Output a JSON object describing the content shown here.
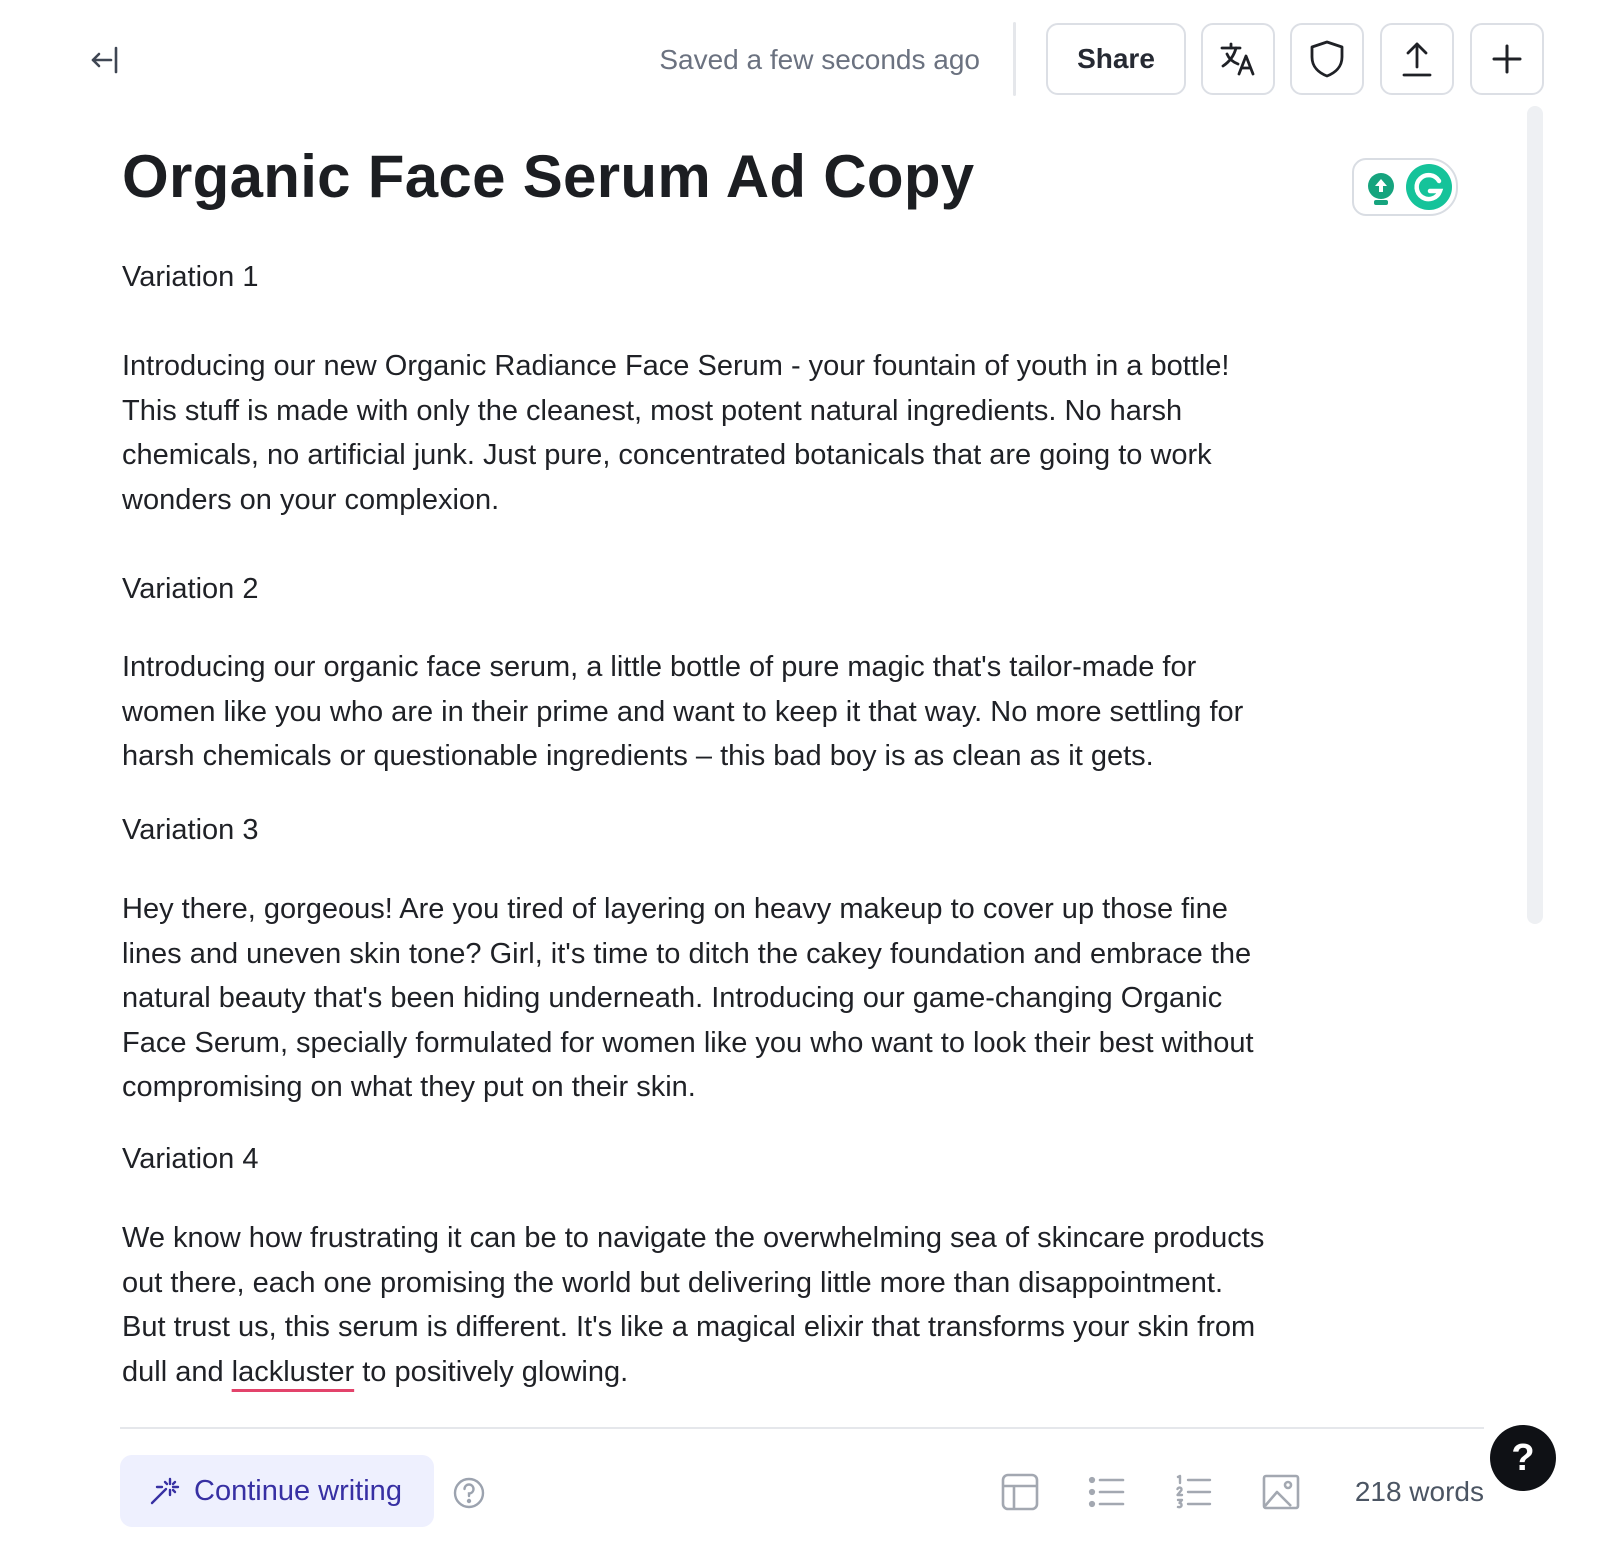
{
  "toolbar": {
    "collapse_icon": "collapse-left-icon",
    "saved_status": "Saved a few seconds ago",
    "share_label": "Share",
    "translate_icon": "translate-icon",
    "shield_icon": "shield-icon",
    "export_icon": "upload-icon",
    "new_icon": "plus-icon"
  },
  "document": {
    "title": "Organic Face Serum Ad Copy",
    "sections": [
      {
        "heading": "Variation 1",
        "lines": [
          "Introducing our new Organic Radiance Face Serum - your fountain of youth in a bottle!",
          "This stuff is made with only the cleanest, most potent natural ingredients. No harsh",
          "chemicals, no artificial junk. Just pure, concentrated botanicals that are going to work",
          "wonders on your complexion."
        ]
      },
      {
        "heading": "Variation 2",
        "lines": [
          "Introducing our organic face serum, a little bottle of pure magic that's tailor-made for",
          "women like you who are in their prime and want to keep it that way. No more settling for",
          "harsh chemicals or questionable ingredients – this bad boy is as clean as it gets."
        ]
      },
      {
        "heading": "Variation 3",
        "lines": [
          "Hey there, gorgeous! Are you tired of layering on heavy makeup to cover up those fine",
          "lines and uneven skin tone? Girl, it's time to ditch the cakey foundation and embrace the",
          "natural beauty that's been hiding underneath. Introducing our game-changing Organic",
          "Face Serum, specially formulated for women like you who want to look their best without",
          "compromising on what they put on their skin."
        ]
      },
      {
        "heading": "Variation 4",
        "lines": [
          "We know how frustrating it can be to navigate the overwhelming sea of skincare products",
          "out there, each one promising the world but delivering little more than disappointment.",
          "But trust us, this serum is different. It's like a magical elixir that transforms your skin from"
        ],
        "last_line": {
          "before": "dull and ",
          "flagged_word": "lackluster",
          "after": " to positively glowing."
        }
      }
    ]
  },
  "assistant": {
    "grammarly_icon": "grammarly-icon",
    "suggestion_icon": "lightbulb-icon"
  },
  "footer": {
    "continue_label": "Continue writing",
    "continue_icon": "magic-wand-icon",
    "help_icon": "question-circle-icon",
    "format_icons": [
      "table-icon",
      "bullet-list-icon",
      "numbered-list-icon",
      "image-icon"
    ],
    "word_count": "218 words",
    "support_label": "?"
  },
  "colors": {
    "accent": "#3730a3",
    "accent_bg": "#eef0fe",
    "grammarly_green": "#15c39a",
    "spell_error": "#e3436b",
    "muted_text": "#6b7280"
  }
}
